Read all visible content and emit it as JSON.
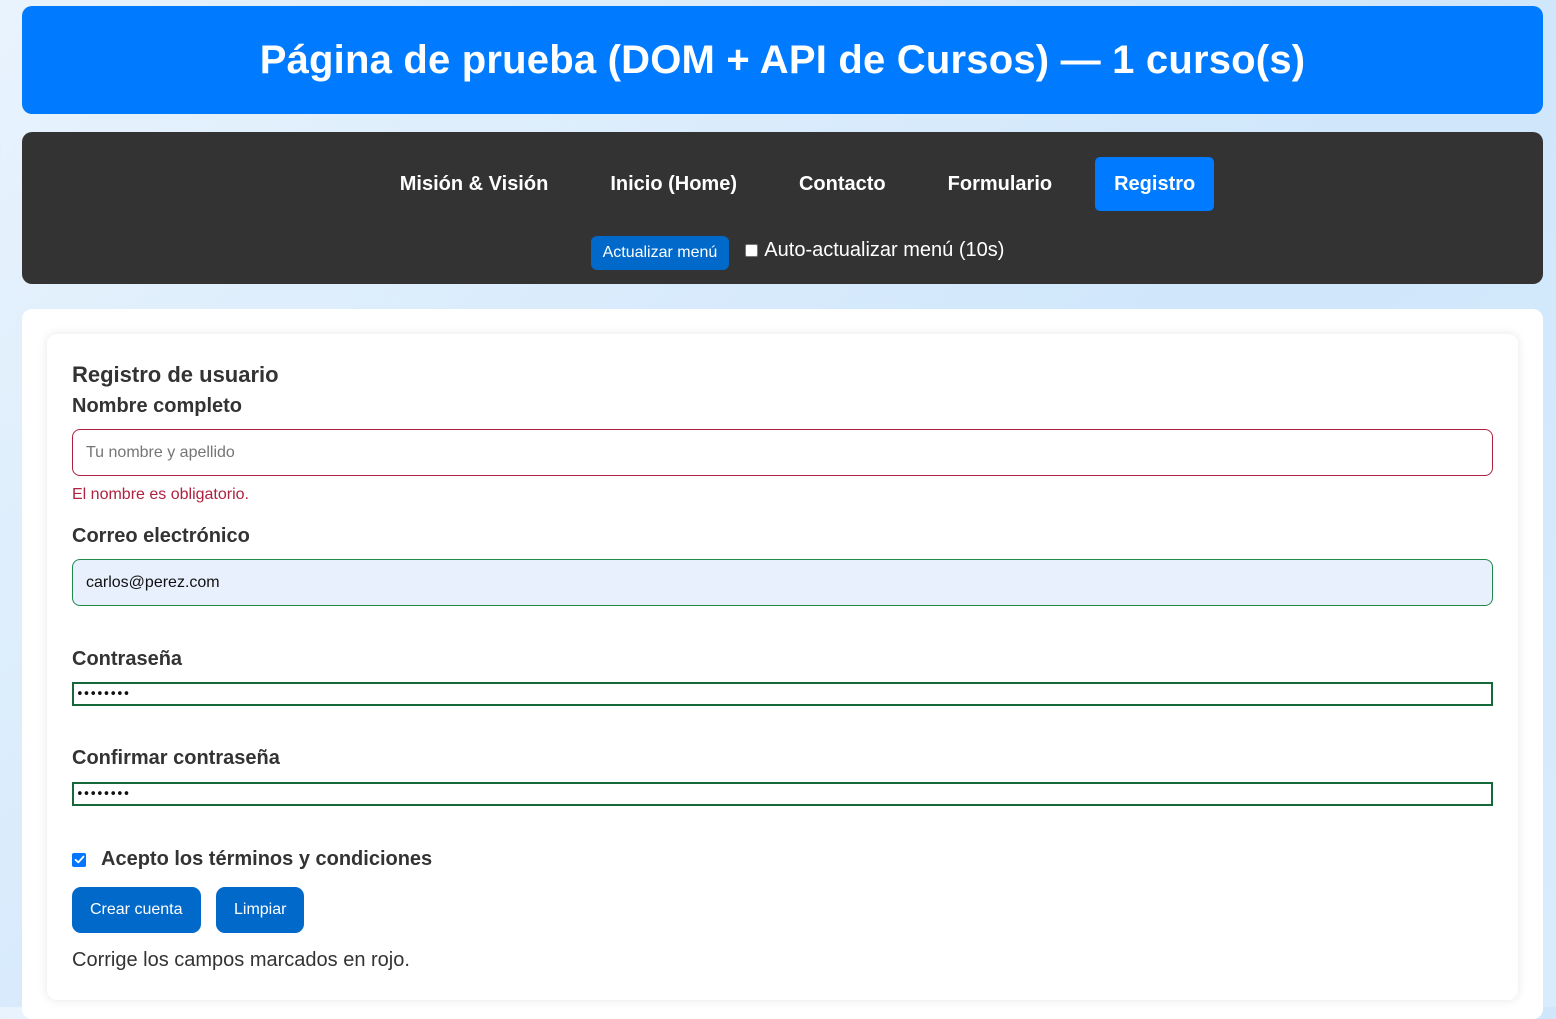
{
  "header": {
    "title": "Página de prueba (DOM + API de Cursos) — 1 curso(s)"
  },
  "nav": {
    "links": [
      {
        "label": "Misión & Visión",
        "active": false
      },
      {
        "label": "Inicio (Home)",
        "active": false
      },
      {
        "label": "Contacto",
        "active": false
      },
      {
        "label": "Formulario",
        "active": false
      },
      {
        "label": "Registro",
        "active": true
      }
    ],
    "refresh_button": "Actualizar menú",
    "auto_refresh": {
      "label": "Auto-actualizar menú (10s)",
      "checked": false
    }
  },
  "form": {
    "title": "Registro de usuario",
    "name": {
      "label": "Nombre completo",
      "placeholder": "Tu nombre y apellido",
      "value": "",
      "error": "El nombre es obligatorio."
    },
    "email": {
      "label": "Correo electrónico",
      "value": "carlos@perez.com"
    },
    "password": {
      "label": "Contraseña",
      "masked_value": "••••••••"
    },
    "confirm_password": {
      "label": "Confirmar contraseña",
      "masked_value": "••••••••"
    },
    "terms": {
      "label": "Acepto los términos y condiciones",
      "checked": true
    },
    "submit_button": "Crear cuenta",
    "reset_button": "Limpiar",
    "status_message": "Corrige los campos marcados en rojo."
  },
  "colors": {
    "header_bg": "#007bff",
    "nav_bg": "#333333",
    "active_link_bg": "#007bff",
    "button_bg": "#0069c9",
    "error": "#b0213f",
    "valid": "#1e8a4c"
  }
}
